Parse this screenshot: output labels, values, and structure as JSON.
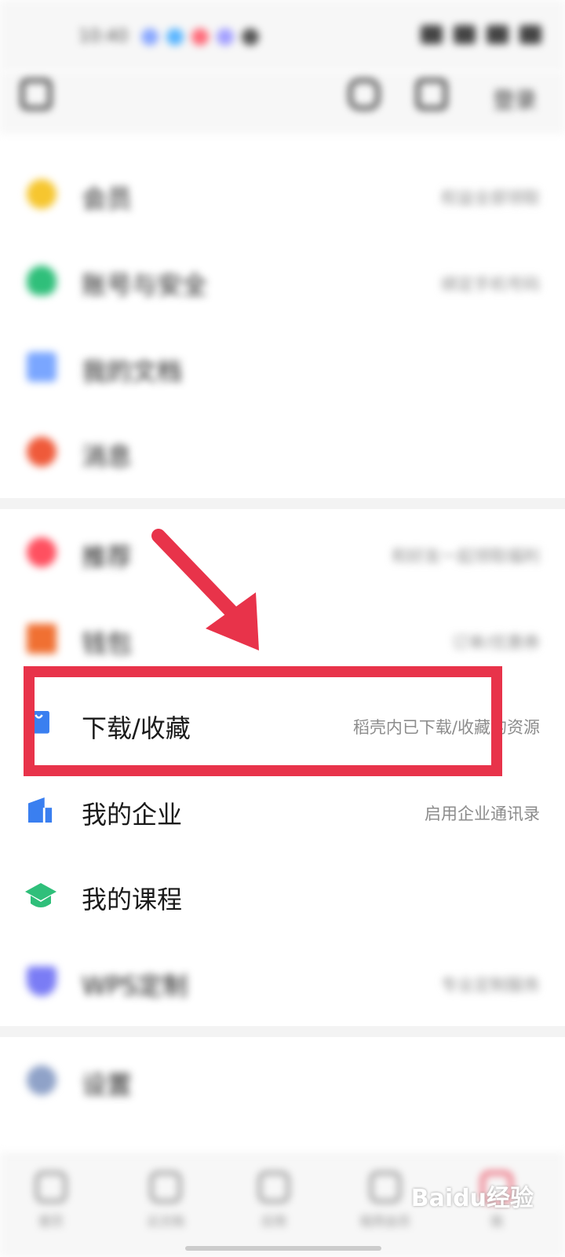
{
  "status_bar": {
    "time": "10:40"
  },
  "header": {
    "right_label": "登录"
  },
  "menu_blurred_top": [
    {
      "label": "会员",
      "hint": "权益全部领取"
    },
    {
      "label": "账号与安全",
      "hint": "绑定手机号码"
    },
    {
      "label": "我的文档",
      "hint": ""
    },
    {
      "label": "消息",
      "hint": ""
    }
  ],
  "menu_blurred_mid": [
    {
      "label": "推荐",
      "hint": "和好友一起领取福利"
    },
    {
      "label": "钱包",
      "hint": "订单/优惠券"
    }
  ],
  "menu_clear": [
    {
      "label": "下载/收藏",
      "hint": "稻壳内已下载/收藏的资源"
    },
    {
      "label": "我的企业",
      "hint": "启用企业通讯录"
    },
    {
      "label": "我的课程",
      "hint": ""
    }
  ],
  "menu_blurred_bottom": [
    {
      "label": "WPS定制",
      "hint": "专业定制服务"
    },
    {
      "label": "设置",
      "hint": ""
    }
  ],
  "bottom_nav": [
    {
      "label": "首页"
    },
    {
      "label": "云文档"
    },
    {
      "label": "应用"
    },
    {
      "label": "稻壳会员"
    },
    {
      "label": "我"
    }
  ],
  "watermark": "Baidu经验",
  "colors": {
    "annotation_red": "#e8334a",
    "download_icon_blue": "#3a7ff0",
    "enterprise_icon_blue": "#3a7ff0",
    "course_icon_green": "#2fbf7a"
  }
}
